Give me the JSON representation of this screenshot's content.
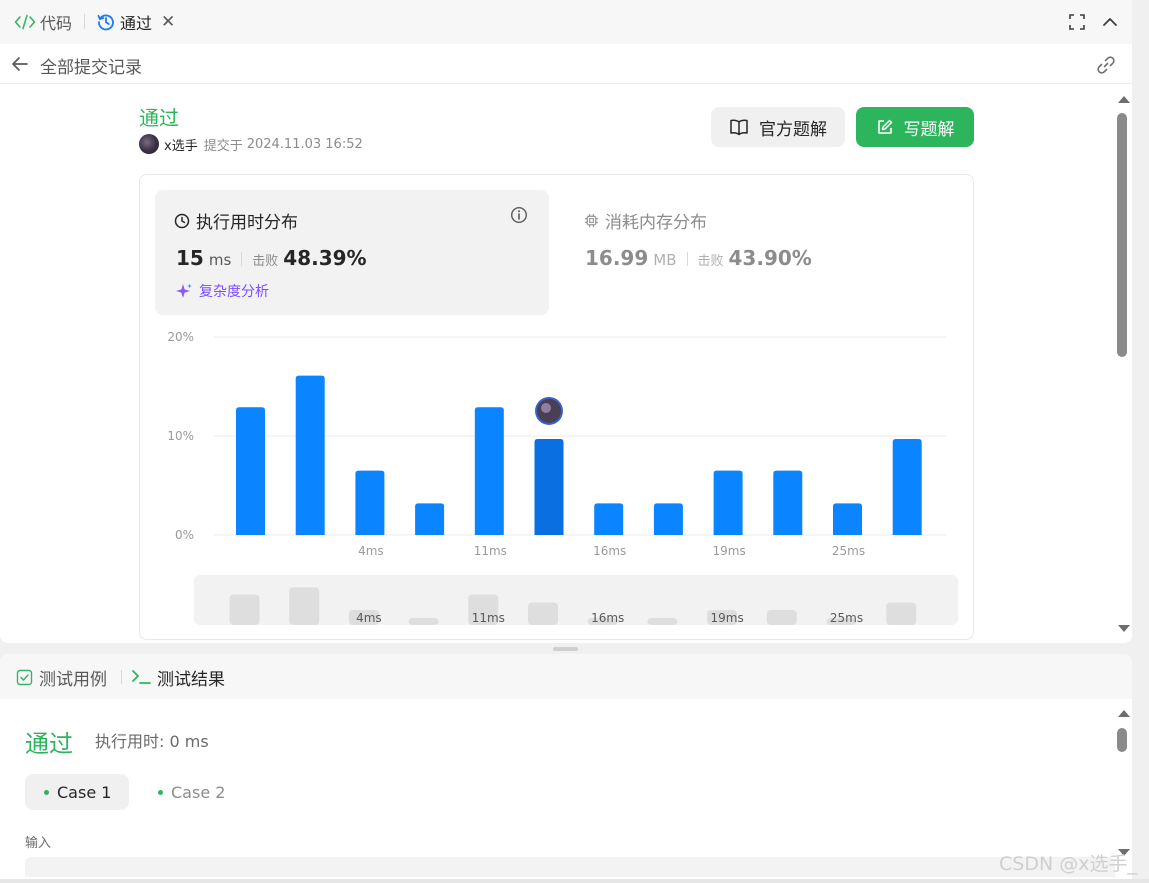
{
  "tabs": {
    "code_label": "代码",
    "pass_label": "通过",
    "close_symbol": "✕"
  },
  "subbar": {
    "back_label": "全部提交记录"
  },
  "submission": {
    "status": "通过",
    "username": "x选手",
    "submitted_label": "提交于",
    "submitted_time": "2024.11.03 16:52",
    "official_solution_label": "官方题解",
    "write_solution_label": "写题解"
  },
  "runtime": {
    "title": "执行用时分布",
    "value": "15",
    "unit": "ms",
    "beat_label": "击败",
    "beat_pct": "48.39%",
    "complexity_label": "复杂度分析"
  },
  "memory": {
    "title": "消耗内存分布",
    "value": "16.99",
    "unit": "MB",
    "beat_label": "击败",
    "beat_pct": "43.90%"
  },
  "chart_data": {
    "type": "bar",
    "ylabel": "",
    "xlabel": "",
    "ylim": [
      0,
      20
    ],
    "y_ticks": [
      "0%",
      "10%",
      "20%"
    ],
    "grid": true,
    "values": [
      12.9,
      16.1,
      6.5,
      3.2,
      12.9,
      9.7,
      3.2,
      3.2,
      6.5,
      6.5,
      3.2,
      9.7
    ],
    "x_tick_labels": [
      "",
      "",
      "4ms",
      "",
      "11ms",
      "",
      "16ms",
      "",
      "19ms",
      "",
      "25ms",
      ""
    ],
    "highlight_index": 5,
    "bar_color": "#0a84ff",
    "highlight_color": "#0a6fe0",
    "overview_values": [
      6.5,
      8.0,
      3.2,
      1.5,
      6.5,
      4.8,
      1.5,
      1.5,
      3.2,
      3.2,
      1.5,
      4.8
    ],
    "overview_tick_labels": [
      "",
      "",
      "4ms",
      "",
      "11ms",
      "",
      "16ms",
      "",
      "19ms",
      "",
      "25ms",
      ""
    ]
  },
  "bottom": {
    "tab_cases": "测试用例",
    "tab_results": "测试结果",
    "result_status": "通过",
    "exec_time": "执行用时: 0 ms",
    "case1": "Case 1",
    "case2": "Case 2",
    "input_label": "输入"
  },
  "watermark": "CSDN @x选手_",
  "colors": {
    "accent_green": "#2db55d",
    "accent_blue": "#0a84ff",
    "ai_purple": "#7c4dff"
  }
}
